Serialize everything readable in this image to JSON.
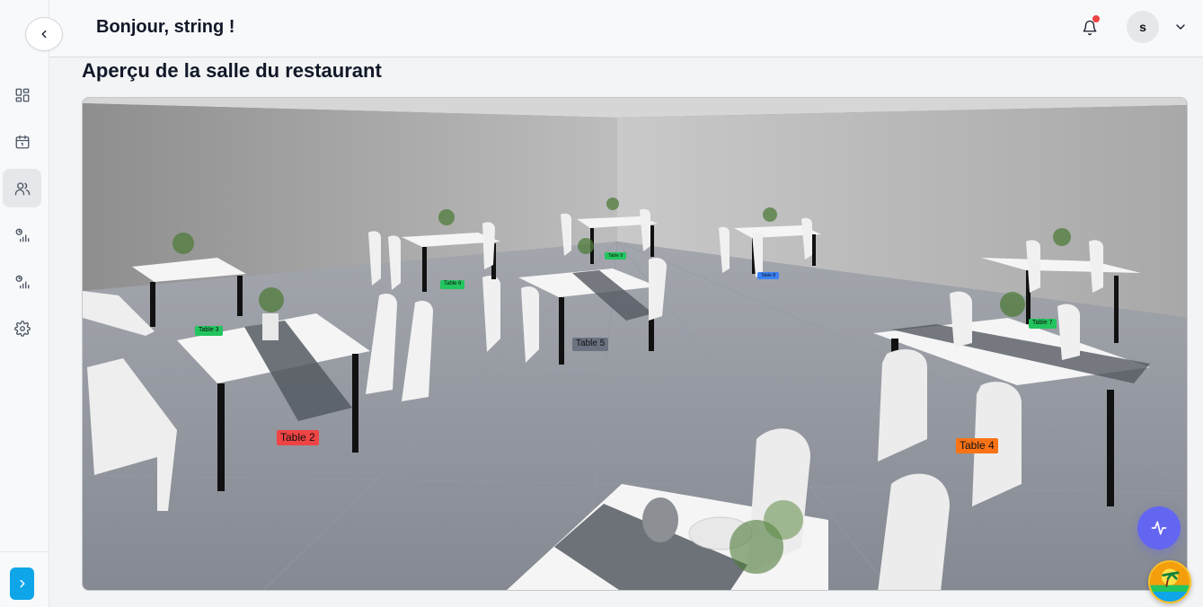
{
  "header": {
    "greeting": "Bonjour, string !",
    "avatar_initial": "s",
    "notification_dot_color": "#ef4444"
  },
  "sidebar": {
    "items": [
      {
        "icon": "dashboard-icon",
        "active": false
      },
      {
        "icon": "calendar-icon",
        "active": false
      },
      {
        "icon": "users-icon",
        "active": true
      },
      {
        "icon": "stats-icon",
        "active": false
      },
      {
        "icon": "reports-icon",
        "active": false
      },
      {
        "icon": "settings-icon",
        "active": false
      }
    ]
  },
  "main": {
    "title": "Aperçu de la salle du restaurant"
  },
  "scene": {
    "tables": [
      {
        "label": "Table 2",
        "color": "#ef4444"
      },
      {
        "label": "Table 3",
        "color": "#22c55e"
      },
      {
        "label": "Table 4",
        "color": "#f97316"
      },
      {
        "label": "Table 5",
        "color": "#6b7280"
      },
      {
        "label": "Table 6",
        "color": "#22c55e"
      },
      {
        "label": "Table 7",
        "color": "#22c55e"
      },
      {
        "label": "Table 8",
        "color": "#3b82f6"
      },
      {
        "label": "Table 9",
        "color": "#22c55e"
      }
    ]
  },
  "accent": "#6366f1"
}
